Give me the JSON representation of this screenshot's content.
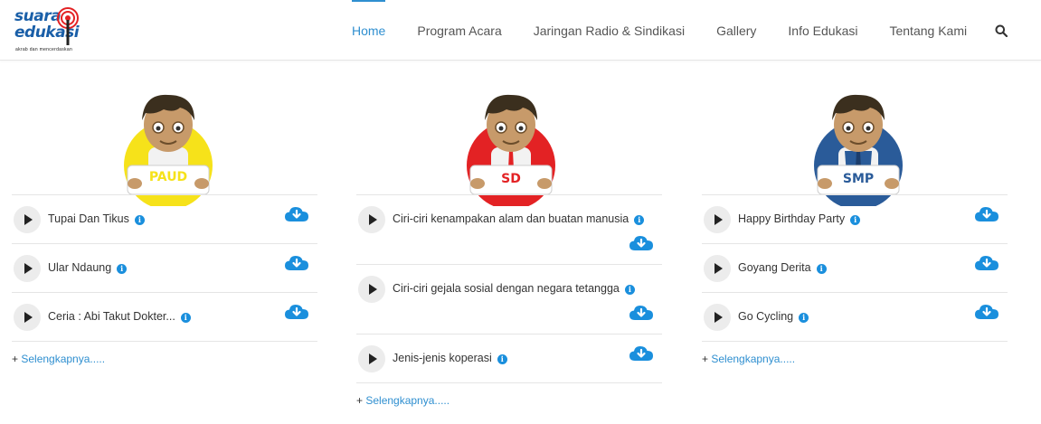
{
  "logo": {
    "line1": "suara",
    "line2": "edukasi",
    "tagline": "akrab dan mencerdaskan"
  },
  "nav": {
    "items": [
      {
        "label": "Home",
        "active": true
      },
      {
        "label": "Program Acara"
      },
      {
        "label": "Jaringan Radio & Sindikasi"
      },
      {
        "label": "Gallery"
      },
      {
        "label": "Info Edukasi"
      },
      {
        "label": "Tentang Kami"
      }
    ]
  },
  "colors": {
    "accent": "#2f8fd0",
    "paud": "#f6e21a",
    "sd": "#e32224",
    "smp": "#2a5b99"
  },
  "columns": [
    {
      "badge": "PAUD",
      "tracks": [
        {
          "title": "Tupai Dan Tikus"
        },
        {
          "title": "Ular Ndaung"
        },
        {
          "title": "Ceria : Abi Takut Dokter..."
        }
      ],
      "more_prefix": "+ ",
      "more_link": "Selengkapnya....."
    },
    {
      "badge": "SD",
      "tracks": [
        {
          "title": "Ciri-ciri kenampakan alam dan buatan manusia"
        },
        {
          "title": "Ciri-ciri gejala sosial dengan negara tetangga"
        },
        {
          "title": "Jenis-jenis koperasi"
        }
      ],
      "more_prefix": "+ ",
      "more_link": "Selengkapnya....."
    },
    {
      "badge": "SMP",
      "tracks": [
        {
          "title": "Happy Birthday Party"
        },
        {
          "title": "Goyang Derita"
        },
        {
          "title": "Go Cycling"
        }
      ],
      "more_prefix": "+ ",
      "more_link": "Selengkapnya....."
    }
  ]
}
